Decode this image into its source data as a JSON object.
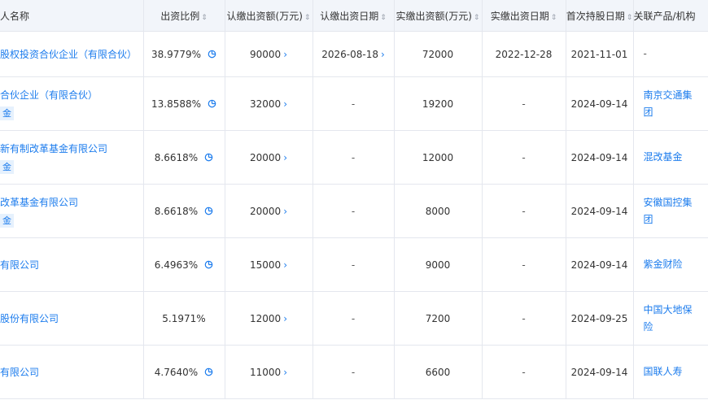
{
  "headers": {
    "name": "人名称",
    "ratio": "出资比例",
    "subscribed_amount": "认缴出资额(万元)",
    "subscribed_date": "认缴出资日期",
    "paid_amount": "实缴出资额(万元)",
    "paid_date": "实缴出资日期",
    "first_hold_date": "首次持股日期",
    "related": "关联产品/机构"
  },
  "sort_icon": "sort-icon",
  "colors": {
    "link": "#1c7ced",
    "header_bg": "#f2f5fa",
    "border": "#e4e7ee",
    "tag_bg": "#e6f1fd"
  },
  "rows": [
    {
      "name": "股权投资合伙企业（有限合伙）",
      "tag": "",
      "ratio": "38.9779%",
      "chart_icon": true,
      "subscribed_amount": "90000",
      "subscribed_date": "2026-08-18",
      "subscribed_date_link": true,
      "paid_amount": "72000",
      "paid_date": "2022-12-28",
      "first_hold_date": "2021-11-01",
      "related": "-",
      "related_link": false
    },
    {
      "name": "合伙企业（有限合伙）",
      "tag": "金",
      "ratio": "13.8588%",
      "chart_icon": true,
      "subscribed_amount": "32000",
      "subscribed_date": "-",
      "subscribed_date_link": false,
      "paid_amount": "19200",
      "paid_date": "-",
      "first_hold_date": "2024-09-14",
      "related": "南京交通集团",
      "related_link": true
    },
    {
      "name": "新有制改革基金有限公司",
      "tag": "金",
      "ratio": "8.6618%",
      "chart_icon": true,
      "subscribed_amount": "20000",
      "subscribed_date": "-",
      "subscribed_date_link": false,
      "paid_amount": "12000",
      "paid_date": "-",
      "first_hold_date": "2024-09-14",
      "related": "混改基金",
      "related_link": true
    },
    {
      "name": "改革基金有限公司",
      "tag": "金",
      "ratio": "8.6618%",
      "chart_icon": true,
      "subscribed_amount": "20000",
      "subscribed_date": "-",
      "subscribed_date_link": false,
      "paid_amount": "8000",
      "paid_date": "-",
      "first_hold_date": "2024-09-14",
      "related": "安徽国控集团",
      "related_link": true
    },
    {
      "name": "有限公司",
      "tag": "",
      "ratio": "6.4963%",
      "chart_icon": true,
      "subscribed_amount": "15000",
      "subscribed_date": "-",
      "subscribed_date_link": false,
      "paid_amount": "9000",
      "paid_date": "-",
      "first_hold_date": "2024-09-14",
      "related": "紫金财险",
      "related_link": true
    },
    {
      "name": "股份有限公司",
      "tag": "",
      "ratio": "5.1971%",
      "chart_icon": false,
      "subscribed_amount": "12000",
      "subscribed_date": "-",
      "subscribed_date_link": false,
      "paid_amount": "7200",
      "paid_date": "-",
      "first_hold_date": "2024-09-25",
      "related": "中国大地保险",
      "related_link": true
    },
    {
      "name": "有限公司",
      "tag": "",
      "ratio": "4.7640%",
      "chart_icon": true,
      "subscribed_amount": "11000",
      "subscribed_date": "-",
      "subscribed_date_link": false,
      "paid_amount": "6600",
      "paid_date": "-",
      "first_hold_date": "2024-09-14",
      "related": "国联人寿",
      "related_link": true
    }
  ]
}
